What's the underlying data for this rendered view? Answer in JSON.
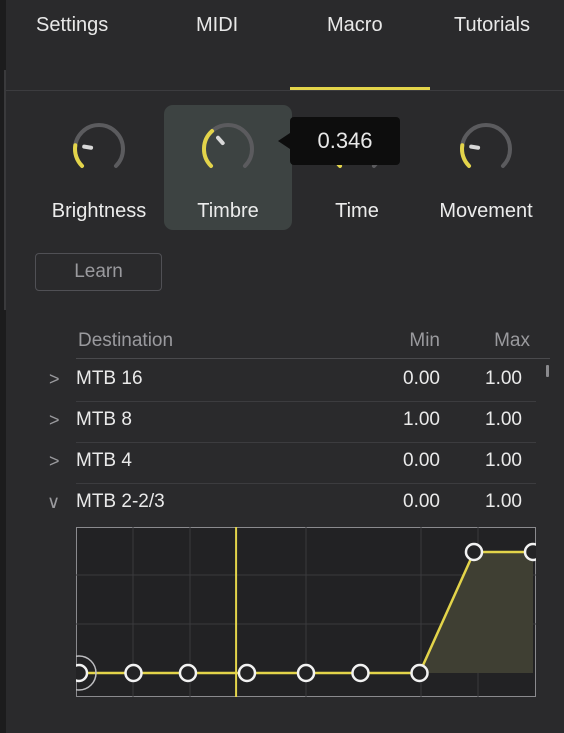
{
  "tabs": [
    {
      "label": "Settings"
    },
    {
      "label": "MIDI"
    },
    {
      "label": "Macro"
    },
    {
      "label": "Tutorials"
    }
  ],
  "active_tab": "Macro",
  "accent_color": "#e3d44a",
  "knobs": [
    {
      "label": "Brightness",
      "value": 0.2
    },
    {
      "label": "Timbre",
      "value": 0.346
    },
    {
      "label": "Time",
      "value": 0.0
    },
    {
      "label": "Movement",
      "value": 0.2
    }
  ],
  "tooltip": {
    "value": "0.346"
  },
  "learn_label": "Learn",
  "table": {
    "headers": {
      "destination": "Destination",
      "min": "Min",
      "max": "Max"
    },
    "rows": [
      {
        "expanded": false,
        "chevron": ">",
        "name": "MTB 16",
        "min": "0.00",
        "max": "1.00"
      },
      {
        "expanded": false,
        "chevron": ">",
        "name": "MTB 8",
        "min": "1.00",
        "max": "1.00"
      },
      {
        "expanded": false,
        "chevron": ">",
        "name": "MTB 4",
        "min": "0.00",
        "max": "1.00"
      },
      {
        "expanded": true,
        "chevron": "∨",
        "name": "MTB 2-2/3",
        "min": "0.00",
        "max": "1.00"
      }
    ]
  },
  "curve": {
    "points": [
      {
        "x": 0.0,
        "y": 0.0
      },
      {
        "x": 0.12,
        "y": 0.0
      },
      {
        "x": 0.24,
        "y": 0.0
      },
      {
        "x": 0.37,
        "y": 0.0
      },
      {
        "x": 0.5,
        "y": 0.0
      },
      {
        "x": 0.62,
        "y": 0.0
      },
      {
        "x": 0.75,
        "y": 0.0
      },
      {
        "x": 0.87,
        "y": 1.0
      },
      {
        "x": 1.0,
        "y": 1.0
      }
    ],
    "playhead": 0.346
  }
}
